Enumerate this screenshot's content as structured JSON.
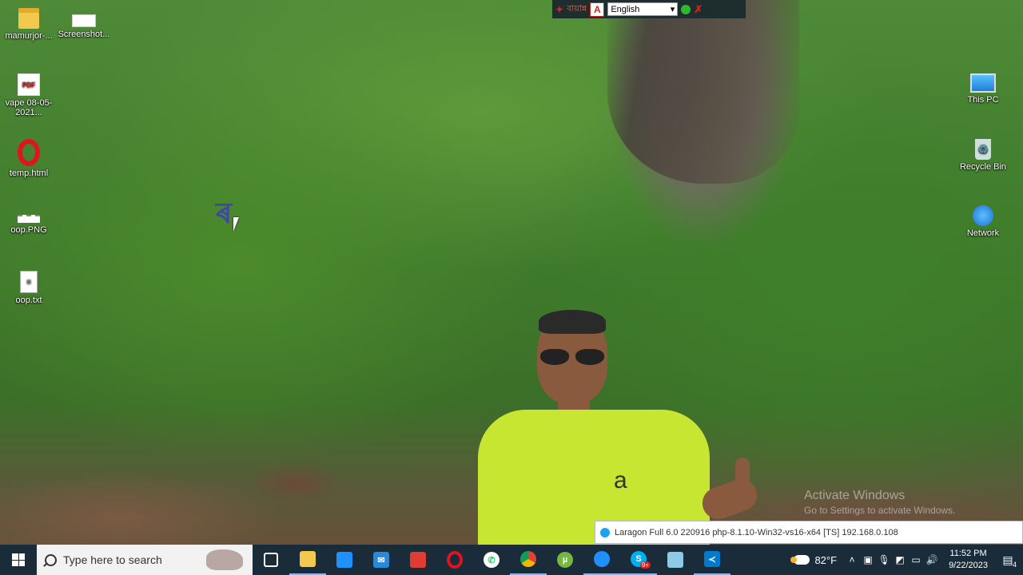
{
  "desktop": {
    "icons_left": [
      {
        "label": "mamurjor-...",
        "icon": "folder-icon"
      },
      {
        "label": "Screenshot...",
        "icon": "image-file-icon"
      },
      {
        "label": "vape 08-05-2021...",
        "icon": "pdf-file-icon"
      },
      {
        "label": "temp.html",
        "icon": "opera-html-icon"
      },
      {
        "label": "oop.PNG",
        "icon": "png-file-icon"
      },
      {
        "label": "oop.txt",
        "icon": "text-file-icon"
      }
    ],
    "icons_right": [
      {
        "label": "This PC",
        "icon": "computer-icon"
      },
      {
        "label": "Recycle Bin",
        "icon": "recycle-bin-icon"
      },
      {
        "label": "Network",
        "icon": "network-icon"
      }
    ],
    "pdf_badge": "PDF",
    "shirt_logo": "a"
  },
  "language_bar": {
    "brand": "বায়ান্ন",
    "language_selected": "English"
  },
  "watermark": {
    "title": "Activate Windows",
    "subtitle": "Go to Settings to activate Windows."
  },
  "tooltip": {
    "text": "Laragon Full 6.0 220916 php-8.1.10-Win32-vs16-x64 [TS]  192.168.0.108"
  },
  "taskbar": {
    "search_placeholder": "Type here to search",
    "apps": [
      {
        "name": "task-view-icon",
        "color": "#ffffff"
      },
      {
        "name": "file-explorer-icon",
        "color": "#f2c94c"
      },
      {
        "name": "microsoft-store-icon",
        "color": "#1e90ff"
      },
      {
        "name": "mail-icon",
        "color": "#2b88d8"
      },
      {
        "name": "office-app-icon",
        "color": "#e03c31"
      },
      {
        "name": "opera-icon",
        "color": "#e0141e"
      },
      {
        "name": "whatsapp-icon",
        "color": "#25d366"
      },
      {
        "name": "chrome-icon",
        "color": "#db4437"
      },
      {
        "name": "utorrent-icon",
        "color": "#76b83f"
      },
      {
        "name": "edge-icon",
        "color": "#1e90ff"
      },
      {
        "name": "skype-icon",
        "color": "#00aff0"
      },
      {
        "name": "notepad-icon",
        "color": "#8ecae6"
      },
      {
        "name": "vscode-icon",
        "color": "#007acc"
      }
    ],
    "skype_badge": "9+",
    "weather": "82°F",
    "time": "11:52 PM",
    "date": "9/22/2023",
    "notification_count": "4"
  }
}
